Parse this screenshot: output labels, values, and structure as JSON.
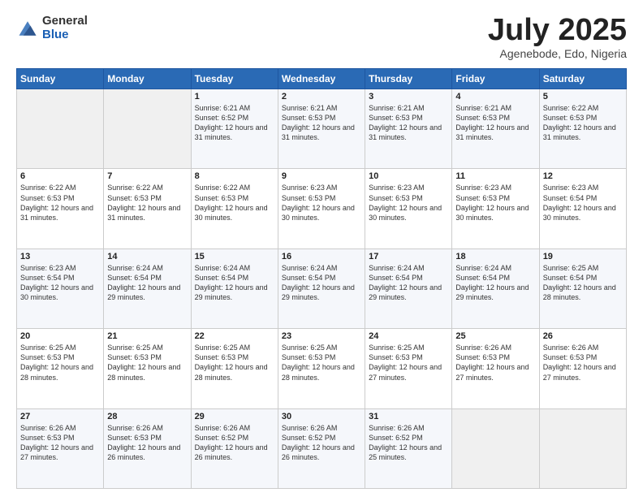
{
  "logo": {
    "general": "General",
    "blue": "Blue"
  },
  "title": {
    "month_year": "July 2025",
    "location": "Agenebode, Edo, Nigeria"
  },
  "weekdays": [
    "Sunday",
    "Monday",
    "Tuesday",
    "Wednesday",
    "Thursday",
    "Friday",
    "Saturday"
  ],
  "weeks": [
    [
      {
        "day": "",
        "sunrise": "",
        "sunset": "",
        "daylight": ""
      },
      {
        "day": "",
        "sunrise": "",
        "sunset": "",
        "daylight": ""
      },
      {
        "day": "1",
        "sunrise": "Sunrise: 6:21 AM",
        "sunset": "Sunset: 6:52 PM",
        "daylight": "Daylight: 12 hours and 31 minutes."
      },
      {
        "day": "2",
        "sunrise": "Sunrise: 6:21 AM",
        "sunset": "Sunset: 6:53 PM",
        "daylight": "Daylight: 12 hours and 31 minutes."
      },
      {
        "day": "3",
        "sunrise": "Sunrise: 6:21 AM",
        "sunset": "Sunset: 6:53 PM",
        "daylight": "Daylight: 12 hours and 31 minutes."
      },
      {
        "day": "4",
        "sunrise": "Sunrise: 6:21 AM",
        "sunset": "Sunset: 6:53 PM",
        "daylight": "Daylight: 12 hours and 31 minutes."
      },
      {
        "day": "5",
        "sunrise": "Sunrise: 6:22 AM",
        "sunset": "Sunset: 6:53 PM",
        "daylight": "Daylight: 12 hours and 31 minutes."
      }
    ],
    [
      {
        "day": "6",
        "sunrise": "Sunrise: 6:22 AM",
        "sunset": "Sunset: 6:53 PM",
        "daylight": "Daylight: 12 hours and 31 minutes."
      },
      {
        "day": "7",
        "sunrise": "Sunrise: 6:22 AM",
        "sunset": "Sunset: 6:53 PM",
        "daylight": "Daylight: 12 hours and 31 minutes."
      },
      {
        "day": "8",
        "sunrise": "Sunrise: 6:22 AM",
        "sunset": "Sunset: 6:53 PM",
        "daylight": "Daylight: 12 hours and 30 minutes."
      },
      {
        "day": "9",
        "sunrise": "Sunrise: 6:23 AM",
        "sunset": "Sunset: 6:53 PM",
        "daylight": "Daylight: 12 hours and 30 minutes."
      },
      {
        "day": "10",
        "sunrise": "Sunrise: 6:23 AM",
        "sunset": "Sunset: 6:53 PM",
        "daylight": "Daylight: 12 hours and 30 minutes."
      },
      {
        "day": "11",
        "sunrise": "Sunrise: 6:23 AM",
        "sunset": "Sunset: 6:53 PM",
        "daylight": "Daylight: 12 hours and 30 minutes."
      },
      {
        "day": "12",
        "sunrise": "Sunrise: 6:23 AM",
        "sunset": "Sunset: 6:54 PM",
        "daylight": "Daylight: 12 hours and 30 minutes."
      }
    ],
    [
      {
        "day": "13",
        "sunrise": "Sunrise: 6:23 AM",
        "sunset": "Sunset: 6:54 PM",
        "daylight": "Daylight: 12 hours and 30 minutes."
      },
      {
        "day": "14",
        "sunrise": "Sunrise: 6:24 AM",
        "sunset": "Sunset: 6:54 PM",
        "daylight": "Daylight: 12 hours and 29 minutes."
      },
      {
        "day": "15",
        "sunrise": "Sunrise: 6:24 AM",
        "sunset": "Sunset: 6:54 PM",
        "daylight": "Daylight: 12 hours and 29 minutes."
      },
      {
        "day": "16",
        "sunrise": "Sunrise: 6:24 AM",
        "sunset": "Sunset: 6:54 PM",
        "daylight": "Daylight: 12 hours and 29 minutes."
      },
      {
        "day": "17",
        "sunrise": "Sunrise: 6:24 AM",
        "sunset": "Sunset: 6:54 PM",
        "daylight": "Daylight: 12 hours and 29 minutes."
      },
      {
        "day": "18",
        "sunrise": "Sunrise: 6:24 AM",
        "sunset": "Sunset: 6:54 PM",
        "daylight": "Daylight: 12 hours and 29 minutes."
      },
      {
        "day": "19",
        "sunrise": "Sunrise: 6:25 AM",
        "sunset": "Sunset: 6:54 PM",
        "daylight": "Daylight: 12 hours and 28 minutes."
      }
    ],
    [
      {
        "day": "20",
        "sunrise": "Sunrise: 6:25 AM",
        "sunset": "Sunset: 6:53 PM",
        "daylight": "Daylight: 12 hours and 28 minutes."
      },
      {
        "day": "21",
        "sunrise": "Sunrise: 6:25 AM",
        "sunset": "Sunset: 6:53 PM",
        "daylight": "Daylight: 12 hours and 28 minutes."
      },
      {
        "day": "22",
        "sunrise": "Sunrise: 6:25 AM",
        "sunset": "Sunset: 6:53 PM",
        "daylight": "Daylight: 12 hours and 28 minutes."
      },
      {
        "day": "23",
        "sunrise": "Sunrise: 6:25 AM",
        "sunset": "Sunset: 6:53 PM",
        "daylight": "Daylight: 12 hours and 28 minutes."
      },
      {
        "day": "24",
        "sunrise": "Sunrise: 6:25 AM",
        "sunset": "Sunset: 6:53 PM",
        "daylight": "Daylight: 12 hours and 27 minutes."
      },
      {
        "day": "25",
        "sunrise": "Sunrise: 6:26 AM",
        "sunset": "Sunset: 6:53 PM",
        "daylight": "Daylight: 12 hours and 27 minutes."
      },
      {
        "day": "26",
        "sunrise": "Sunrise: 6:26 AM",
        "sunset": "Sunset: 6:53 PM",
        "daylight": "Daylight: 12 hours and 27 minutes."
      }
    ],
    [
      {
        "day": "27",
        "sunrise": "Sunrise: 6:26 AM",
        "sunset": "Sunset: 6:53 PM",
        "daylight": "Daylight: 12 hours and 27 minutes."
      },
      {
        "day": "28",
        "sunrise": "Sunrise: 6:26 AM",
        "sunset": "Sunset: 6:53 PM",
        "daylight": "Daylight: 12 hours and 26 minutes."
      },
      {
        "day": "29",
        "sunrise": "Sunrise: 6:26 AM",
        "sunset": "Sunset: 6:52 PM",
        "daylight": "Daylight: 12 hours and 26 minutes."
      },
      {
        "day": "30",
        "sunrise": "Sunrise: 6:26 AM",
        "sunset": "Sunset: 6:52 PM",
        "daylight": "Daylight: 12 hours and 26 minutes."
      },
      {
        "day": "31",
        "sunrise": "Sunrise: 6:26 AM",
        "sunset": "Sunset: 6:52 PM",
        "daylight": "Daylight: 12 hours and 25 minutes."
      },
      {
        "day": "",
        "sunrise": "",
        "sunset": "",
        "daylight": ""
      },
      {
        "day": "",
        "sunrise": "",
        "sunset": "",
        "daylight": ""
      }
    ]
  ]
}
